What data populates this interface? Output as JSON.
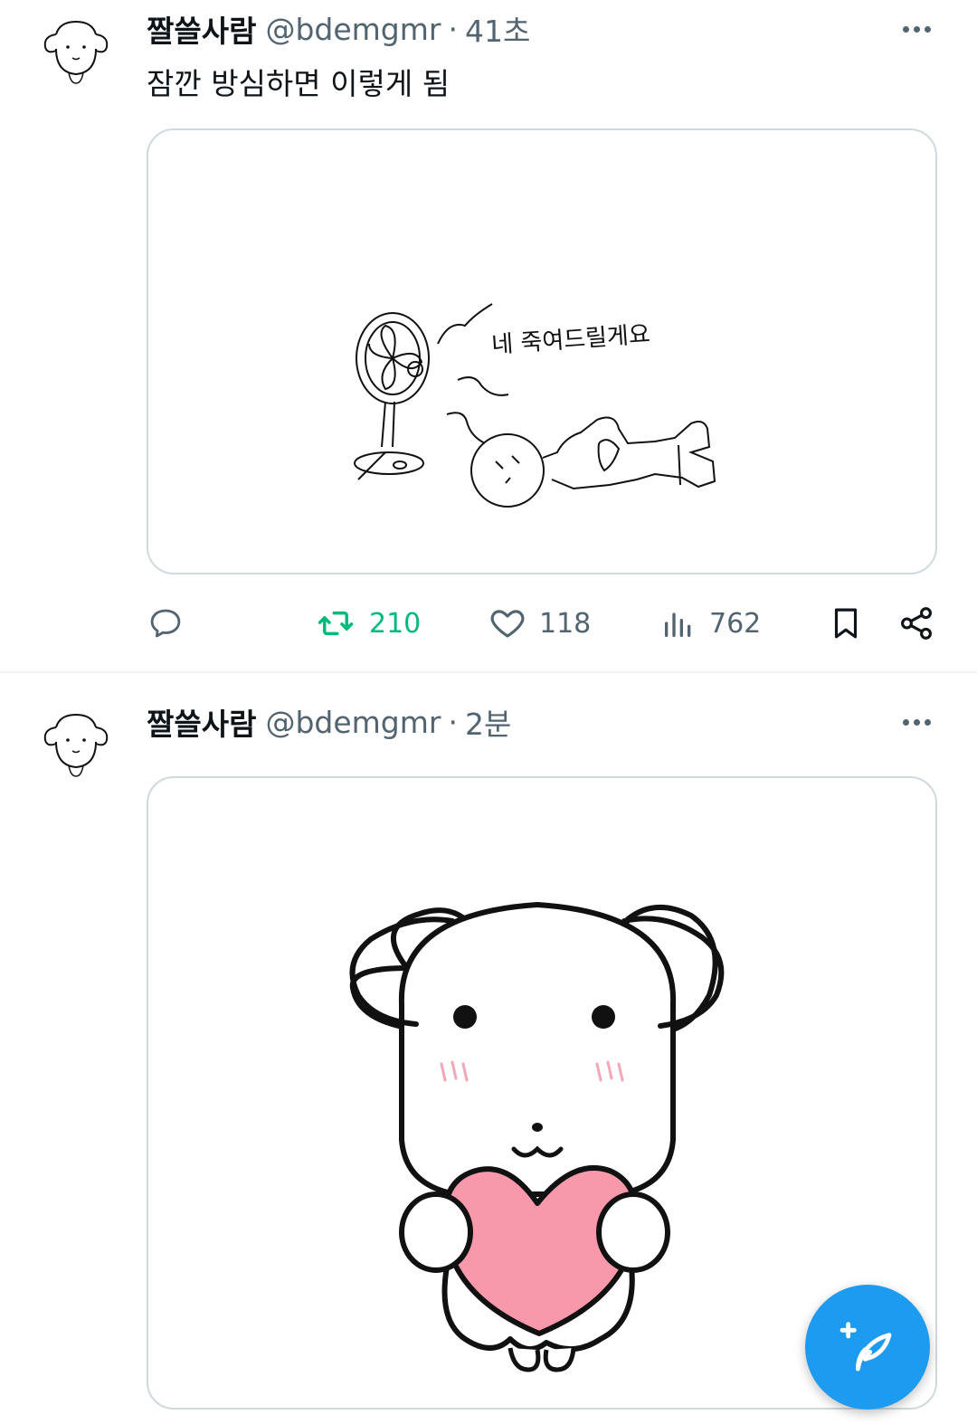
{
  "tweets": [
    {
      "author_name": "짤쓸사람",
      "handle": "@bdemgmr",
      "separator": "·",
      "time": "41초",
      "text": "잠깐 방심하면 이렇게 됨",
      "drawing_text": "네  죽여드릴게요",
      "stats": {
        "retweets": "210",
        "likes": "118",
        "views": "762"
      }
    },
    {
      "author_name": "짤쓸사람",
      "handle": "@bdemgmr",
      "separator": "·",
      "time": "2분"
    }
  ],
  "icons": {
    "reply": "reply-icon",
    "retweet": "retweet-icon",
    "like": "heart-icon",
    "views": "views-icon",
    "bookmark": "bookmark-icon",
    "share": "share-icon",
    "compose": "compose-icon"
  },
  "colors": {
    "retweet_active": "#00ba7c",
    "accent": "#1d9bf0",
    "muted": "#536471",
    "heart_fill": "#f799ab",
    "blush": "#f4a7b6"
  }
}
